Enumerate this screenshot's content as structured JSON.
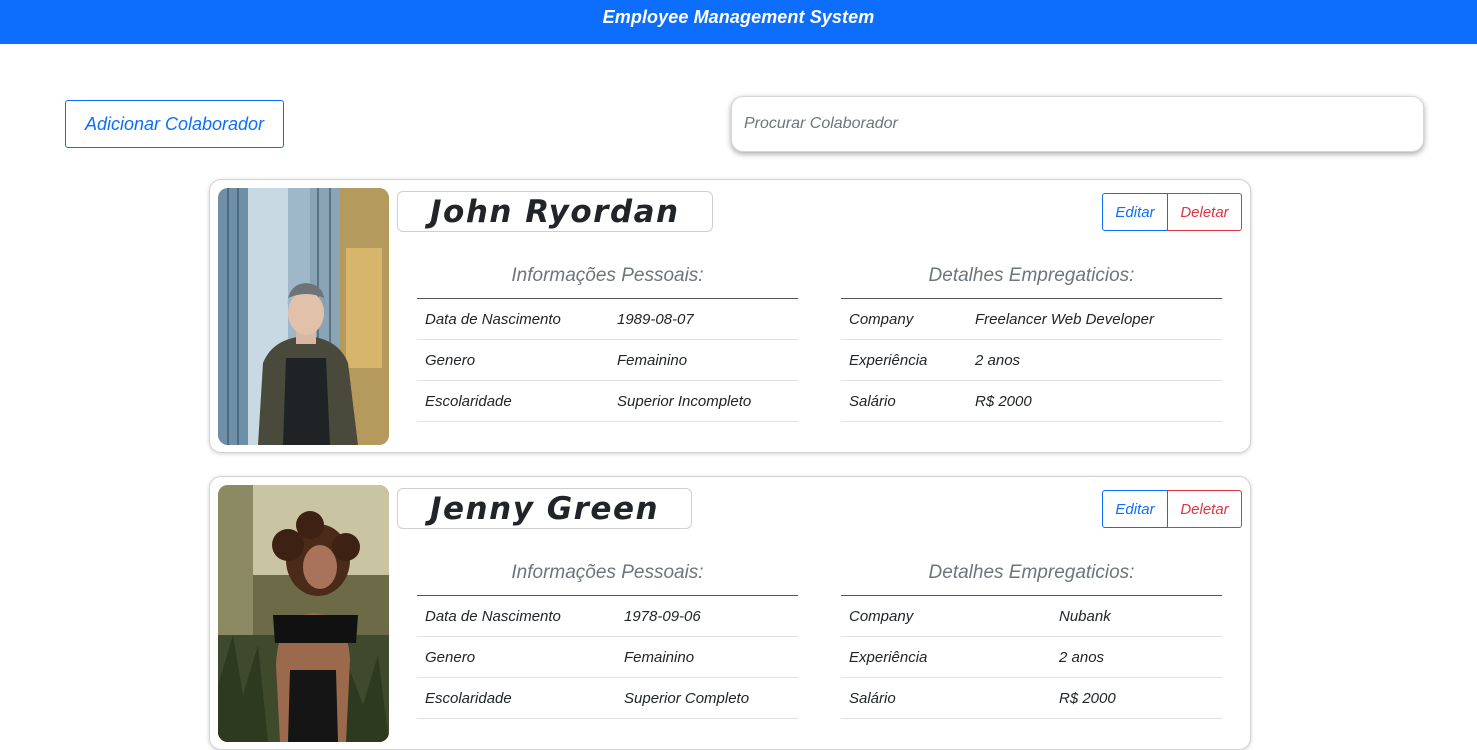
{
  "header": {
    "title": "Employee Management System"
  },
  "toolbar": {
    "add_label": "Adicionar Colaborador",
    "search_placeholder": "Procurar Colaborador"
  },
  "colors": {
    "primary": "#0d6efd",
    "danger": "#dc3545",
    "muted": "#6c757d"
  },
  "employees": [
    {
      "name": "John Ryordan",
      "edit_label": "Editar",
      "delete_label": "Deletar",
      "personal_title": "Informações Pessoais:",
      "employment_title": "Detalhes Empregaticios:",
      "personal": [
        {
          "label": "Data de Nascimento",
          "value": "1989-08-07"
        },
        {
          "label": "Genero",
          "value": "Femainino"
        },
        {
          "label": "Escolaridade",
          "value": "Superior Incompleto"
        }
      ],
      "employment": [
        {
          "label": "Company",
          "value": "Freelancer Web Developer"
        },
        {
          "label": "Experiência",
          "value": "2 anos"
        },
        {
          "label": "Salário",
          "value": "R$ 2000"
        }
      ]
    },
    {
      "name": "Jenny Green",
      "edit_label": "Editar",
      "delete_label": "Deletar",
      "personal_title": "Informações Pessoais:",
      "employment_title": "Detalhes Empregaticios:",
      "personal": [
        {
          "label": "Data de Nascimento",
          "value": "1978-09-06"
        },
        {
          "label": "Genero",
          "value": "Femainino"
        },
        {
          "label": "Escolaridade",
          "value": "Superior Completo"
        }
      ],
      "employment": [
        {
          "label": "Company",
          "value": "Nubank"
        },
        {
          "label": "Experiência",
          "value": "2 anos"
        },
        {
          "label": "Salário",
          "value": "R$ 2000"
        }
      ]
    }
  ]
}
